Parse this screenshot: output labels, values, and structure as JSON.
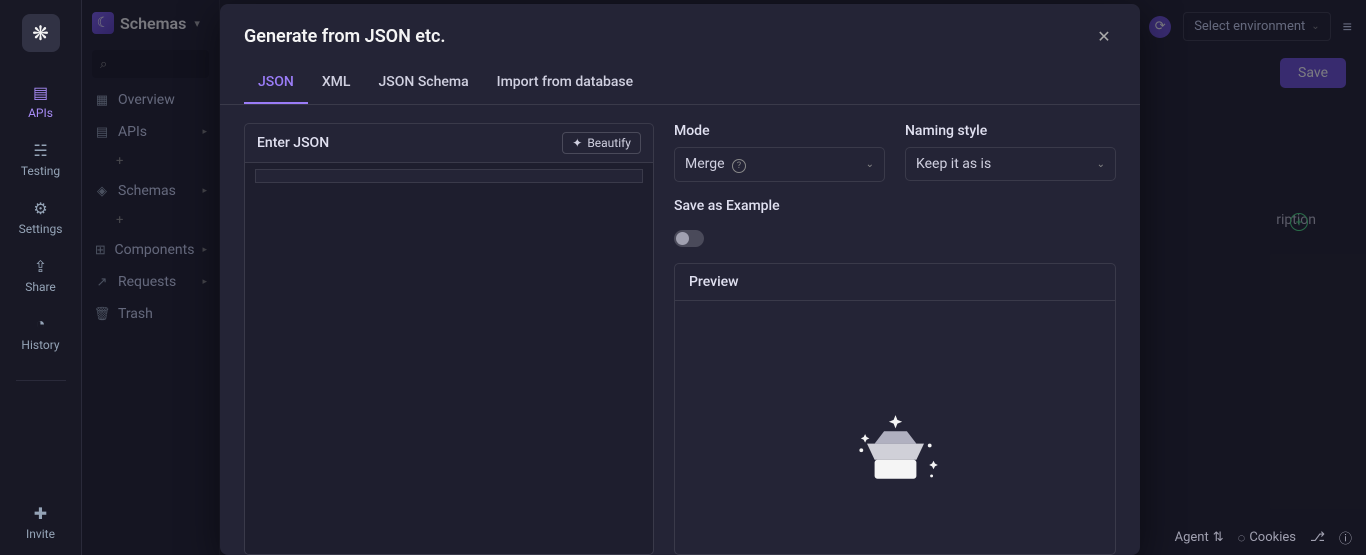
{
  "rail": {
    "items": [
      {
        "label": "APIs"
      },
      {
        "label": "Testing"
      },
      {
        "label": "Settings"
      },
      {
        "label": "Share"
      },
      {
        "label": "History"
      }
    ],
    "invite": "Invite"
  },
  "sidebar": {
    "title": "Schemas",
    "items": [
      {
        "label": "Overview"
      },
      {
        "label": "APIs"
      },
      {
        "label": "Schemas"
      },
      {
        "label": "Components"
      },
      {
        "label": "Requests"
      },
      {
        "label": "Trash"
      }
    ]
  },
  "topbar": {
    "env_placeholder": "Select environment",
    "save": "Save"
  },
  "bg": {
    "description": "ription"
  },
  "modal": {
    "title": "Generate from JSON etc.",
    "tabs": [
      {
        "label": "JSON",
        "active": true
      },
      {
        "label": "XML"
      },
      {
        "label": "JSON Schema"
      },
      {
        "label": "Import from database"
      }
    ],
    "editor_title": "Enter JSON",
    "beautify": "Beautify",
    "controls": {
      "mode_label": "Mode",
      "mode_value": "Merge",
      "naming_label": "Naming style",
      "naming_value": "Keep it as is",
      "save_example_label": "Save as Example"
    },
    "preview_title": "Preview"
  },
  "bottombar": {
    "agent": "Agent",
    "cookies": "Cookies"
  }
}
